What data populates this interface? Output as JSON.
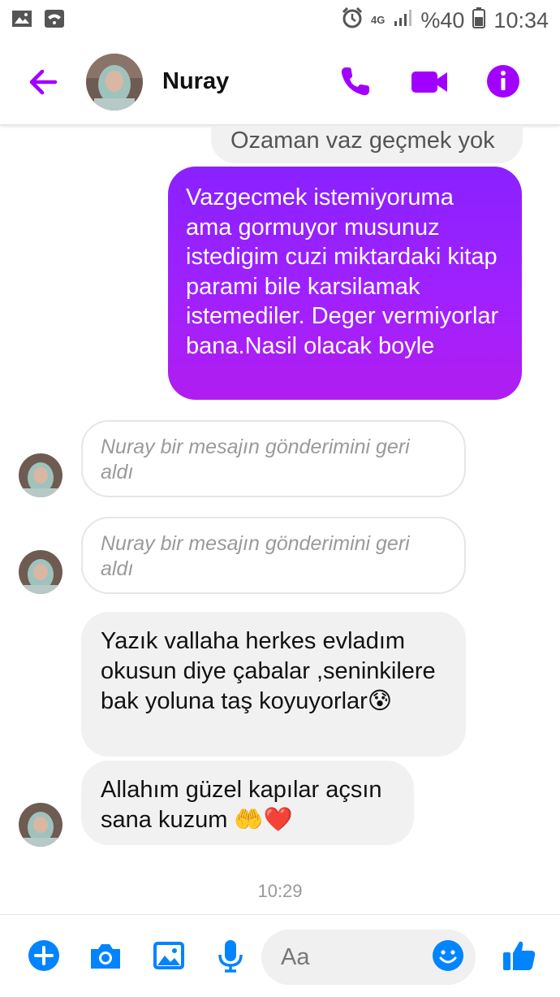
{
  "status_bar": {
    "network": "4G",
    "battery": "%40",
    "time": "10:34",
    "icons": [
      "image-icon",
      "wifi-icon",
      "alarm-icon",
      "signal-icon",
      "battery-icon"
    ]
  },
  "header": {
    "contact_name": "Nuray",
    "icons": [
      "back-arrow-icon",
      "phone-icon",
      "video-camera-icon",
      "info-icon"
    ],
    "accent_color": "#a100ff"
  },
  "messages": {
    "truncated_incoming": "Ozaman vaz geçmek yok",
    "outgoing": "Vazgecmek istemiyoruma ama gormuyor musunuz istedigim cuzi miktardaki kitap parami bile karsilamak istemediler. Deger vermiyorlar bana.Nasil olacak boyle",
    "unsent_1": "Nuray bir mesajın gönderimini geri aldı",
    "unsent_2": "Nuray bir mesajın gönderimini geri aldı",
    "incoming_1": "Yazık vallaha herkes evladım okusun diye çabalar ,seninkilere bak yoluna taş koyuyorlar😰",
    "incoming_2": "Allahım güzel kapılar açsın sana kuzum 🤲❤️",
    "timestamp": "10:29"
  },
  "composer": {
    "placeholder": "Aa",
    "icons": [
      "plus-icon",
      "camera-icon",
      "gallery-icon",
      "microphone-icon",
      "emoji-icon",
      "thumbs-up-icon"
    ],
    "icon_color": "#0084ff"
  }
}
